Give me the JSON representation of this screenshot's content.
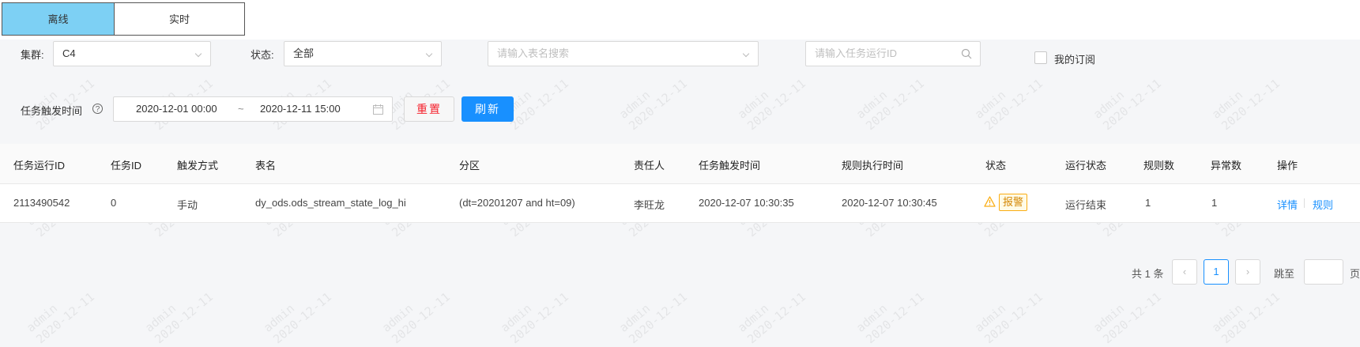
{
  "tabs": [
    {
      "label": "离线",
      "active": true
    },
    {
      "label": "实时",
      "active": false
    }
  ],
  "filters": {
    "cluster_label": "集群:",
    "cluster_value": "C4",
    "status_label": "状态:",
    "status_value": "全部",
    "table_search_placeholder": "请输入表名搜索",
    "run_id_placeholder": "请输入任务运行ID",
    "subscription_label": "我的订阅",
    "subscription_checked": false,
    "trigger_time_label": "任务触发时间",
    "help_icon": "?",
    "start_time": "2020-12-01 00:00",
    "range_separator": "~",
    "end_time": "2020-12-11 15:00",
    "reset_label": "重置",
    "refresh_label": "刷新"
  },
  "table": {
    "columns": [
      "任务运行ID",
      "任务ID",
      "触发方式",
      "表名",
      "分区",
      "责任人",
      "任务触发时间",
      "规则执行时间",
      "状态",
      "运行状态",
      "规则数",
      "异常数",
      "操作"
    ],
    "rows": [
      {
        "run_id": "2113490542",
        "task_id": "0",
        "trigger": "手动",
        "table_name": "dy_ods.ods_stream_state_log_hi",
        "partition": "(dt=20201207 and ht=09)",
        "owner": "李旺龙",
        "trigger_time": "2020-12-07 10:30:35",
        "rule_time": "2020-12-07 10:30:45",
        "status": "报警",
        "status_icon": "warning-icon",
        "run_status": "运行结束",
        "rule_count": "1",
        "error_count": "1",
        "action_detail": "详情",
        "action_rule": "规则"
      }
    ]
  },
  "pagination": {
    "total_text": "共 1 条",
    "prev": "‹",
    "current_page": "1",
    "next": "›",
    "jump_label": "跳至",
    "page_suffix": "页"
  },
  "watermark": {
    "user": "admin",
    "date": "2020-12-11"
  },
  "colors": {
    "active_tab": "#7dd0f4",
    "primary": "#1890ff",
    "reset_text": "#f5222d",
    "warning": "#faad14"
  }
}
